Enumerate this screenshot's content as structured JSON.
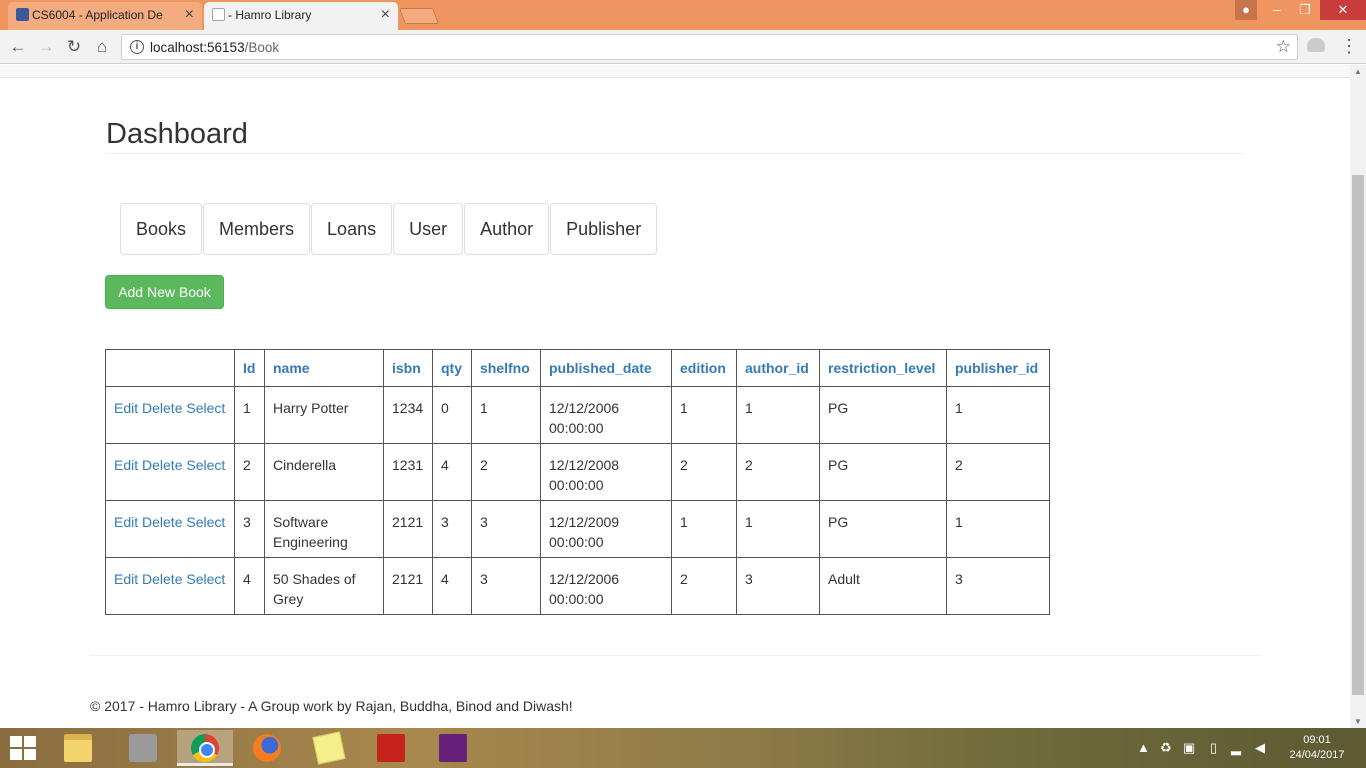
{
  "browser": {
    "tabs": [
      {
        "title": "CS6004 - Application De",
        "active": false
      },
      {
        "title": "- Hamro Library",
        "active": true
      }
    ],
    "url_host": "localhost:56153",
    "url_path": "/Book"
  },
  "page": {
    "title": "Dashboard",
    "nav": [
      "Books",
      "Members",
      "Loans",
      "User",
      "Author",
      "Publisher"
    ],
    "add_button": "Add New Book",
    "table": {
      "columns": [
        "Id",
        "name",
        "isbn",
        "qty",
        "shelfno",
        "published_date",
        "edition",
        "author_id",
        "restriction_level",
        "publisher_id"
      ],
      "row_actions": [
        "Edit",
        "Delete",
        "Select"
      ],
      "rows": [
        {
          "id": "1",
          "name": "Harry Potter",
          "isbn": "1234",
          "qty": "0",
          "shelfno": "1",
          "published_date": "12/12/2006 00:00:00",
          "edition": "1",
          "author_id": "1",
          "restriction_level": "PG",
          "publisher_id": "1"
        },
        {
          "id": "2",
          "name": "Cinderella",
          "isbn": "1231",
          "qty": "4",
          "shelfno": "2",
          "published_date": "12/12/2008 00:00:00",
          "edition": "2",
          "author_id": "2",
          "restriction_level": "PG",
          "publisher_id": "2"
        },
        {
          "id": "3",
          "name": "Software Engineering",
          "isbn": "2121",
          "qty": "3",
          "shelfno": "3",
          "published_date": "12/12/2009 00:00:00",
          "edition": "1",
          "author_id": "1",
          "restriction_level": "PG",
          "publisher_id": "1"
        },
        {
          "id": "4",
          "name": "50 Shades of Grey",
          "isbn": "2121",
          "qty": "4",
          "shelfno": "3",
          "published_date": "12/12/2006 00:00:00",
          "edition": "2",
          "author_id": "3",
          "restriction_level": "Adult",
          "publisher_id": "3"
        }
      ]
    },
    "footer": "© 2017 - Hamro Library - A Group work by Rajan, Buddha, Binod and Diwash!"
  },
  "taskbar": {
    "apps": [
      "file-explorer",
      "system-tool",
      "chrome",
      "firefox",
      "sticky-notes",
      "acrobat-reader",
      "visual-studio"
    ],
    "active_app": "chrome",
    "time": "09:01",
    "date": "24/04/2017"
  },
  "colors": {
    "titlebar": "#ef9560",
    "link": "#337ab7",
    "success": "#5cb85c"
  }
}
